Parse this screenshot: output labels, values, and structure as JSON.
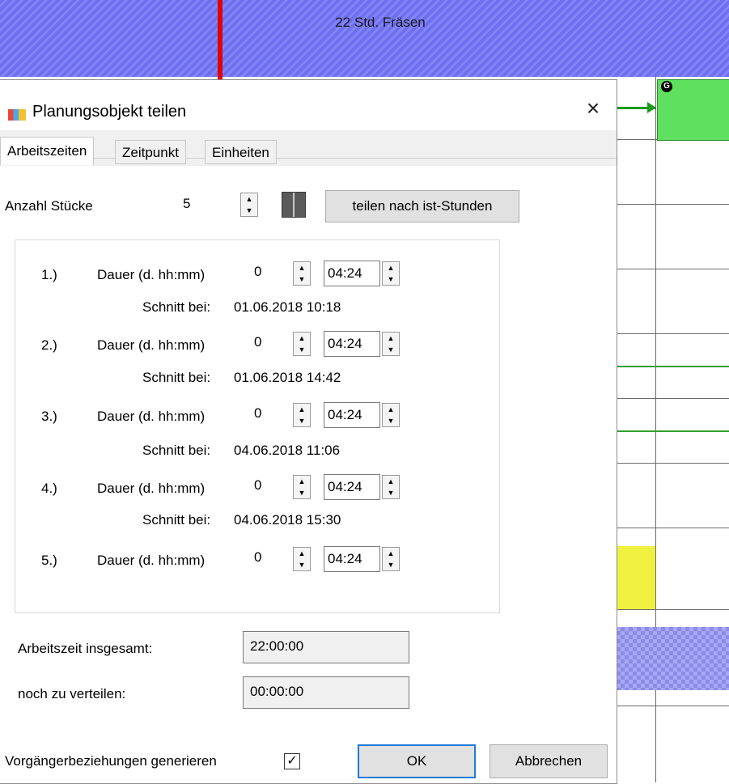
{
  "gantt": {
    "band_label": "22 Std. Fräsen",
    "marker_label": "G",
    "colors": {
      "band": "#7b7df2",
      "marker_line": "#e00000",
      "task_green": "#5fe05f",
      "cell_yellow": "#f0f040"
    }
  },
  "dialog": {
    "title": "Planungsobjekt teilen",
    "close_glyph": "×",
    "tabs": [
      "Arbeitszeiten",
      "Zeitpunkt",
      "Einheiten"
    ],
    "count_label": "Anzahl Stücke",
    "count_value": "5",
    "split_button": "teilen nach ist-Stunden",
    "rows": [
      {
        "num": "1.)",
        "label": "Dauer (d. hh:mm)",
        "days": "0",
        "time": "04:24",
        "cut_label": "Schnitt bei:",
        "cut": "01.06.2018 10:18"
      },
      {
        "num": "2.)",
        "label": "Dauer (d. hh:mm)",
        "days": "0",
        "time": "04:24",
        "cut_label": "Schnitt bei:",
        "cut": "01.06.2018 14:42"
      },
      {
        "num": "3.)",
        "label": "Dauer (d. hh:mm)",
        "days": "0",
        "time": "04:24",
        "cut_label": "Schnitt bei:",
        "cut": "04.06.2018 11:06"
      },
      {
        "num": "4.)",
        "label": "Dauer (d. hh:mm)",
        "days": "0",
        "time": "04:24",
        "cut_label": "Schnitt bei:",
        "cut": "04.06.2018 15:30"
      },
      {
        "num": "5.)",
        "label": "Dauer (d. hh:mm)",
        "days": "0",
        "time": "04:24"
      }
    ],
    "total_label": "Arbeitszeit insgesamt:",
    "total_value": "22:00:00",
    "remaining_label": "noch zu verteilen:",
    "remaining_value": "00:00:00",
    "predecessor_label": "Vorgängerbeziehungen generieren",
    "predecessor_checked": "✓",
    "ok": "OK",
    "cancel": "Abbrechen"
  }
}
